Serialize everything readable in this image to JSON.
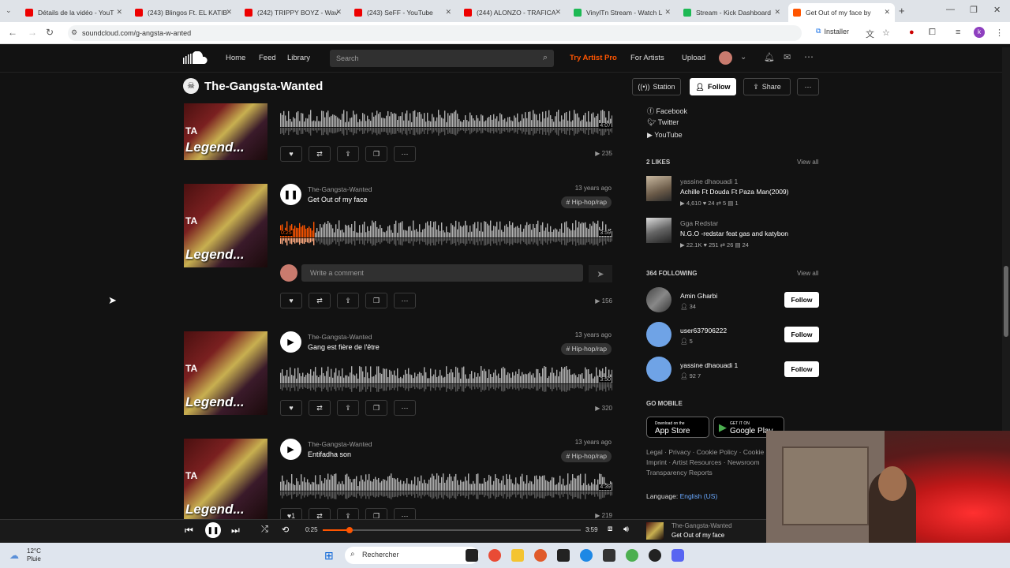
{
  "browser": {
    "tabs": [
      {
        "title": "Détails de la vidéo - YouT",
        "color": "#e00"
      },
      {
        "title": "(243) Blingos Ft. EL KATIB",
        "color": "#e00"
      },
      {
        "title": "(242) TRIPPY BOYZ - Wav",
        "color": "#e00"
      },
      {
        "title": "(243) SeFF - YouTube",
        "color": "#e00"
      },
      {
        "title": "(244) ALONZO - TRAFICA",
        "color": "#e00"
      },
      {
        "title": "VinylTn Stream - Watch L",
        "color": "#1db954"
      },
      {
        "title": "Stream - Kick Dashboard",
        "color": "#1db954"
      },
      {
        "title": "Get Out of my face by",
        "color": "#f50"
      }
    ],
    "url": "soundcloud.com/g-angsta-w-anted",
    "install_label": "Installer",
    "profile_initial": "k"
  },
  "sc_nav": {
    "home": "Home",
    "feed": "Feed",
    "library": "Library",
    "search_placeholder": "Search",
    "try_pro": "Try Artist Pro",
    "for_artists": "For Artists",
    "upload": "Upload"
  },
  "profile": {
    "name": "The-Gangsta-Wanted",
    "station": "Station",
    "follow": "Follow",
    "share": "Share"
  },
  "tracks": [
    {
      "duration": "4:07",
      "plays": "235"
    },
    {
      "artist": "The-Gangsta-Wanted",
      "title": "Get Out of my face",
      "ago": "13 years ago",
      "tag": "# Hip-hop/rap",
      "position": "0:25",
      "duration": "3:59",
      "plays": "156",
      "playing": true,
      "progress": 0.104
    },
    {
      "artist": "The-Gangsta-Wanted",
      "title": "Gang est fière de l'être",
      "ago": "13 years ago",
      "tag": "# Hip-hop/rap",
      "duration": "3:50",
      "plays": "320"
    },
    {
      "artist": "The-Gangsta-Wanted",
      "title": "Entifadha son",
      "ago": "13 years ago",
      "tag": "# Hip-hop/rap",
      "duration": "4:39",
      "plays": "219",
      "likes": "1"
    }
  ],
  "artwork_text": "Legend...",
  "artwork_text2": "TA",
  "comment_placeholder": "Write a comment",
  "sidebar": {
    "socials": [
      "Facebook",
      "Twitter",
      "YouTube"
    ],
    "likes_header": "2 LIKES",
    "view_all": "View all",
    "likes": [
      {
        "user": "yassine dhaouadi 1",
        "title": "Achille Ft Douda Ft Paza Man(2009)",
        "stats": "▶ 4,610   ♥ 24   ⇄ 5   ▤ 1"
      },
      {
        "user": "Gga Redstar",
        "title": "N.G.O -redstar feat gas and katybon",
        "stats": "▶ 22.1K   ♥ 251   ⇄ 26   ▤ 24"
      }
    ],
    "following_header": "364 FOLLOWING",
    "following": [
      {
        "name": "Amin Gharbi",
        "stat": "34"
      },
      {
        "name": "user637906222",
        "stat": "5"
      },
      {
        "name": "yassine dhaouadi 1",
        "stat": "92   7"
      }
    ],
    "follow_label": "Follow",
    "mobile_header": "GO MOBILE",
    "app_store_small": "Download on the",
    "app_store": "App Store",
    "google_small": "GET IT ON",
    "google_play": "Google Play",
    "footer_line1": "Legal · Privacy · Cookie Policy · Cookie",
    "footer_line2": "Imprint · Artist Resources · Newsroom",
    "footer_line3": "Transparency Reports",
    "language_label": "Language:",
    "language_value": "English (US)"
  },
  "player": {
    "position": "0:25",
    "duration": "3:59",
    "artist": "The-Gangsta-Wanted",
    "title": "Get Out of my face",
    "progress": 0.104
  },
  "taskbar": {
    "temp": "12°C",
    "weather": "Pluie",
    "search": "Rechercher"
  },
  "colors": {
    "accent": "#ff5500",
    "bg": "#121212"
  }
}
